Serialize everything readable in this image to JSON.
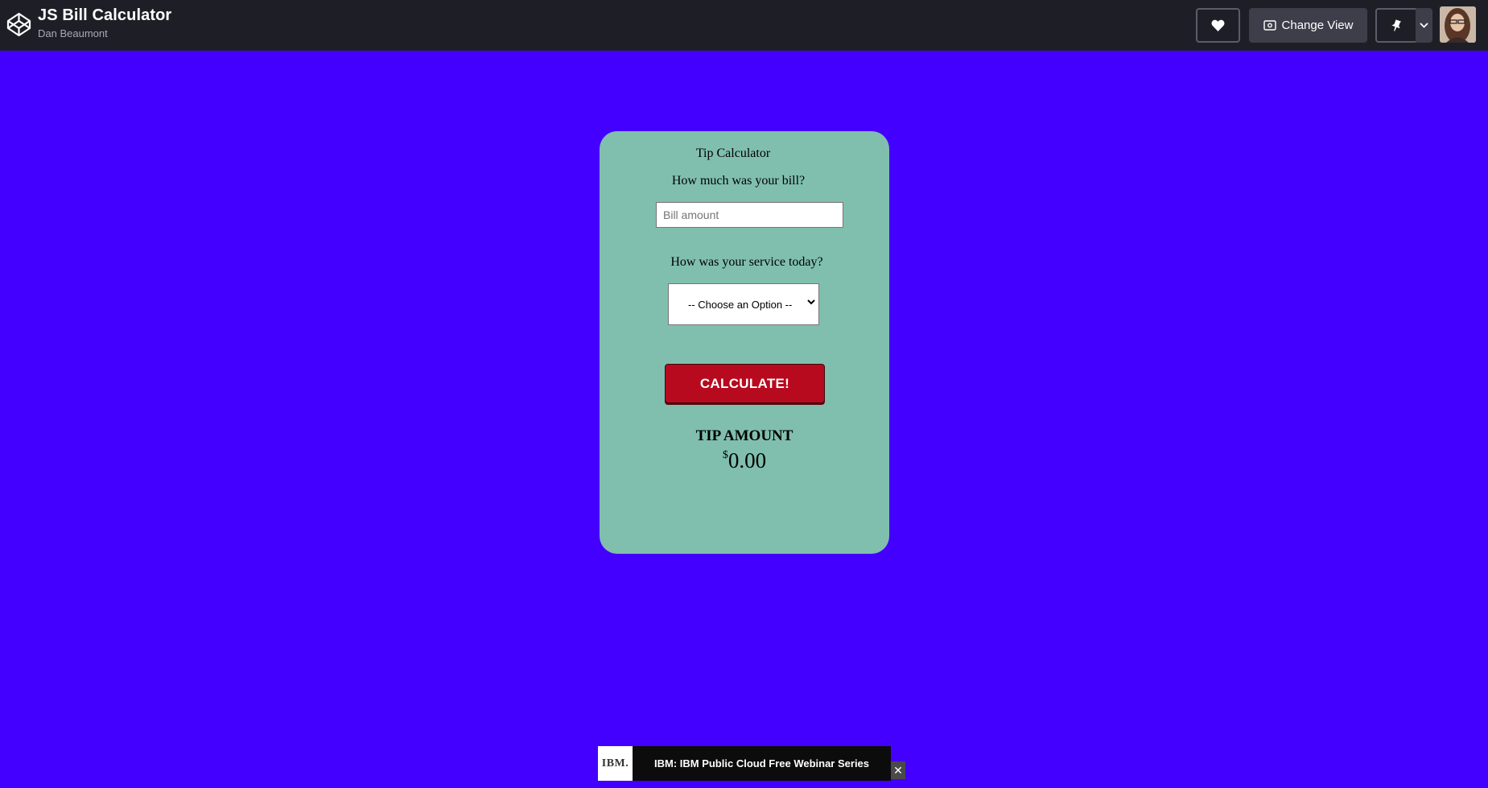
{
  "header": {
    "title": "JS Bill Calculator",
    "author": "Dan Beaumont",
    "change_view_label": "Change View",
    "background": "#1e1f26"
  },
  "icons": {
    "logo": "codepen-logo-icon",
    "heart": "heart-icon",
    "change_view": "eye-window-icon",
    "pin": "pin-icon",
    "dropdown": "chevron-down-icon"
  },
  "page": {
    "background": "#4400ff"
  },
  "calculator": {
    "title": "Tip Calculator",
    "bill_question": "How much was your bill?",
    "bill_placeholder": "Bill amount",
    "bill_value": "",
    "service_question": "How was your service today?",
    "service_selected": "-- Choose an Option --",
    "calculate_label": "CALCULATE!",
    "tip_label": "TIP AMOUNT",
    "currency_symbol": "$",
    "tip_value": "0.00",
    "card_color": "#80bfad",
    "button_color": "#b80a1e"
  },
  "ad": {
    "logo_text": "IBM.",
    "text": "IBM: IBM Public Cloud Free Webinar Series",
    "close_label": "✕"
  }
}
